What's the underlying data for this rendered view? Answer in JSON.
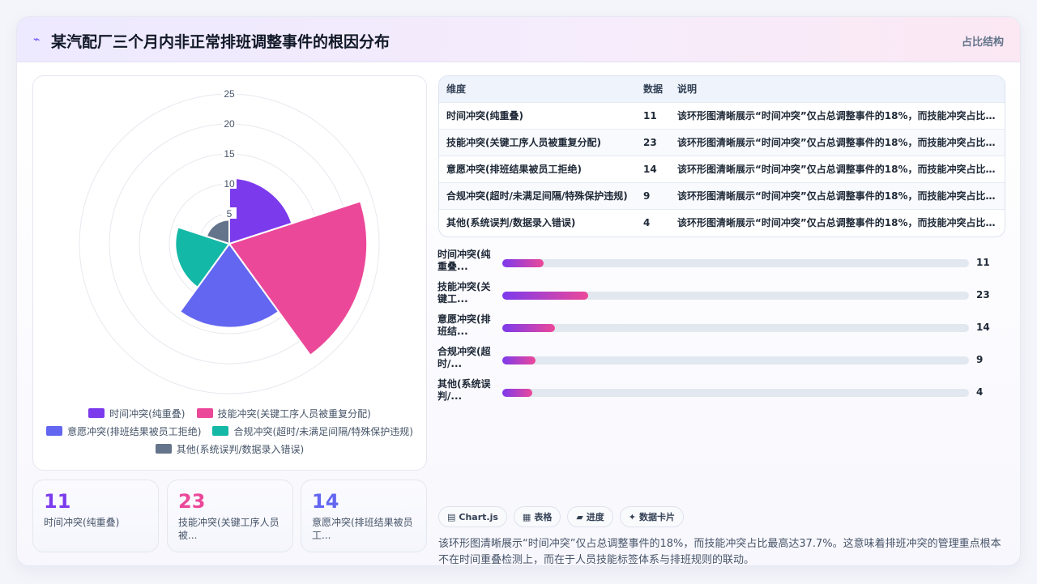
{
  "header": {
    "icon": "sparkle-icon",
    "title": "某汽配厂三个月内非正常排班调整事件的根因分布",
    "tag": "占比结构"
  },
  "colors": {
    "accent": "#7c3aed",
    "pink": "#ec4899",
    "indigo": "#6366f1",
    "teal": "#14b8a6",
    "slate": "#64748b"
  },
  "chart_data": {
    "type": "polarArea",
    "categories": [
      "时间冲突(纯重叠)",
      "技能冲突(关键工序人员被重复分配)",
      "意愿冲突(排班结果被员工拒绝)",
      "合规冲突(超时/未满足间隔/特殊保护违规)",
      "其他(系统误判/数据录入错误)"
    ],
    "values": [
      11,
      23,
      14,
      9,
      4
    ],
    "colors": [
      "#7c3aed",
      "#ec4899",
      "#6366f1",
      "#14b8a6",
      "#64748b"
    ],
    "r_ticks": [
      "5",
      "10",
      "15",
      "20",
      "25"
    ],
    "rlim": [
      0,
      25
    ],
    "legend_position": "bottom"
  },
  "stats": [
    {
      "value": "11",
      "label": "时间冲突(纯重叠)",
      "color": "#7c3aed"
    },
    {
      "value": "23",
      "label": "技能冲突(关键工序人员被...",
      "color": "#ec4899"
    },
    {
      "value": "14",
      "label": "意愿冲突(排班结果被员工...",
      "color": "#6366f1"
    }
  ],
  "table": {
    "headers": [
      "维度",
      "数据",
      "说明"
    ],
    "rows": [
      {
        "dim": "时间冲突(纯重叠)",
        "val": "11",
        "desc": "该环形图清晰展示“时间冲突”仅占总调整事件的18%，而技能冲突占比最..."
      },
      {
        "dim": "技能冲突(关键工序人员被重复分配)",
        "val": "23",
        "desc": "该环形图清晰展示“时间冲突”仅占总调整事件的18%，而技能冲突占比最..."
      },
      {
        "dim": "意愿冲突(排班结果被员工拒绝)",
        "val": "14",
        "desc": "该环形图清晰展示“时间冲突”仅占总调整事件的18%，而技能冲突占比最..."
      },
      {
        "dim": "合规冲突(超时/未满足间隔/特殊保护违规)",
        "val": "9",
        "desc": "该环形图清晰展示“时间冲突”仅占总调整事件的18%，而技能冲突占比最..."
      },
      {
        "dim": "其他(系统误判/数据录入错误)",
        "val": "4",
        "desc": "该环形图清晰展示“时间冲突”仅占总调整事件的18%，而技能冲突占比最..."
      }
    ]
  },
  "bars": [
    {
      "label": "时间冲突(纯重叠...",
      "value": "11"
    },
    {
      "label": "技能冲突(关键工...",
      "value": "23"
    },
    {
      "label": "意愿冲突(排班结...",
      "value": "14"
    },
    {
      "label": "合规冲突(超时/...",
      "value": "9"
    },
    {
      "label": "其他(系统误判/...",
      "value": "4"
    }
  ],
  "bar_fractions": [
    0.088,
    0.184,
    0.112,
    0.072,
    0.064
  ],
  "chips": [
    {
      "icon": "chart-icon",
      "glyph": "▤",
      "label": "Chart.js"
    },
    {
      "icon": "table-icon",
      "glyph": "▦",
      "label": "表格"
    },
    {
      "icon": "progress-icon",
      "glyph": "▰",
      "label": "进度"
    },
    {
      "icon": "card-icon",
      "glyph": "✦",
      "label": "数据卡片"
    }
  ],
  "summary": "该环形图清晰展示“时间冲突”仅占总调整事件的18%，而技能冲突占比最高达37.7%。这意味着排班冲突的管理重点根本不在时间重叠检测上，而在于人员技能标签体系与排班规则的联动。"
}
